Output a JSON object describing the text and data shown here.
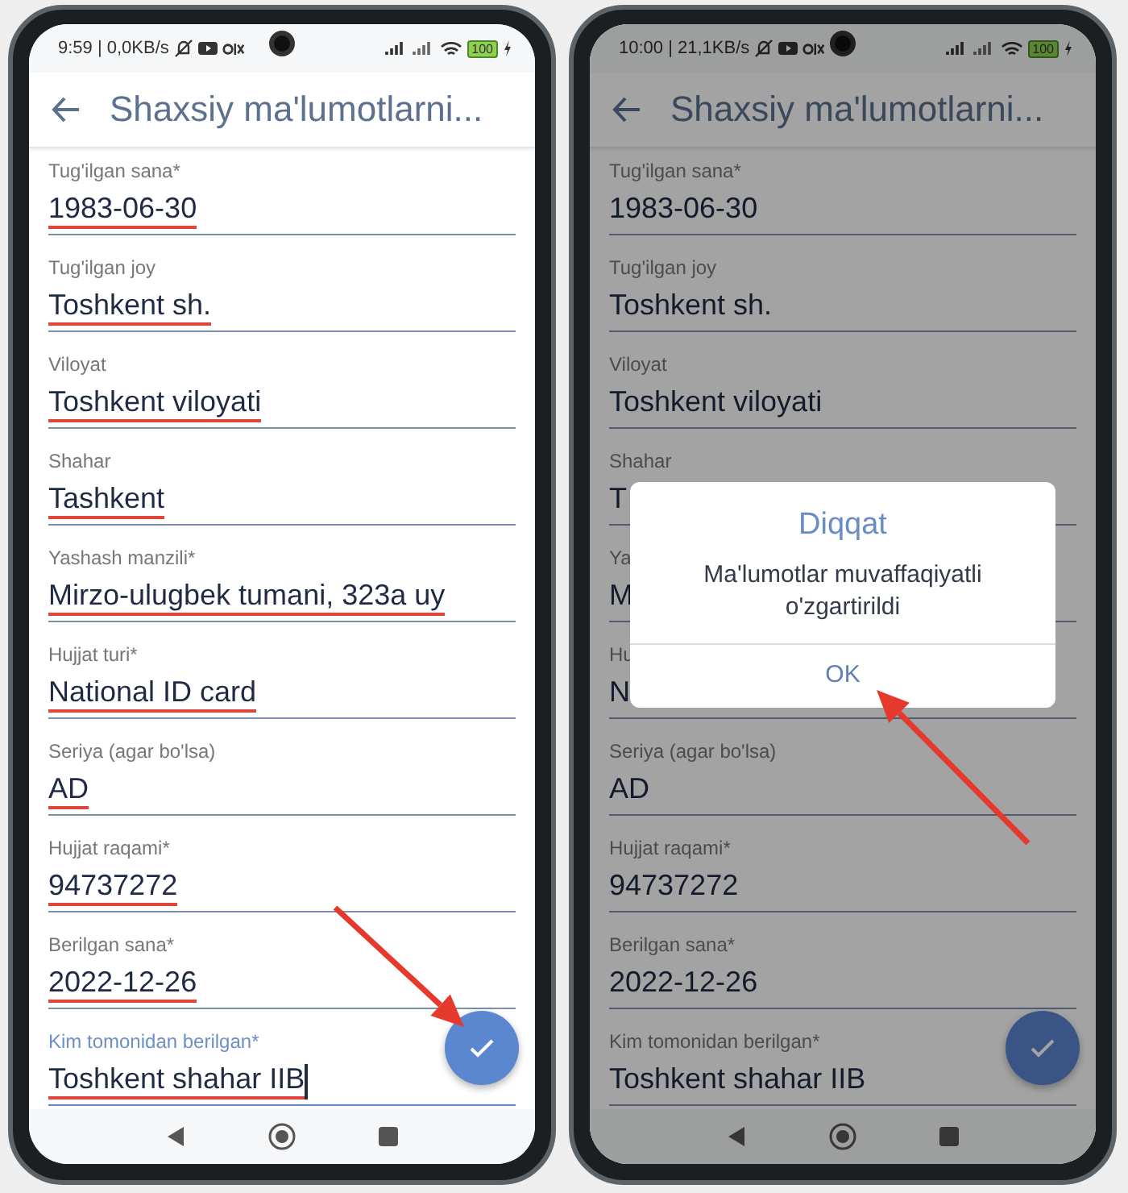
{
  "phones": [
    {
      "status_bar": {
        "time_and_speed": "9:59 | 0,0KB/s",
        "battery": "100"
      },
      "app_bar": {
        "title": "Shaxsiy ma'lumotlarni..."
      },
      "dimmed": false,
      "arrow": true,
      "fields": [
        {
          "label": "Tug'ilgan sana*",
          "value": "1983-06-30",
          "marked": true,
          "focused": false
        },
        {
          "label": "Tug'ilgan joy",
          "value": "Toshkent sh.",
          "marked": true,
          "focused": false
        },
        {
          "label": "Viloyat",
          "value": "Toshkent viloyati",
          "marked": true,
          "focused": false
        },
        {
          "label": "Shahar",
          "value": "Tashkent",
          "marked": true,
          "focused": false
        },
        {
          "label": "Yashash manzili*",
          "value": "Mirzo-ulugbek tumani, 323a uy",
          "marked": true,
          "focused": false
        },
        {
          "label": "Hujjat turi*",
          "value": "National ID card",
          "marked": true,
          "focused": false
        },
        {
          "label": "Seriya (agar bo'lsa)",
          "value": "AD",
          "marked": true,
          "focused": false
        },
        {
          "label": "Hujjat raqami*",
          "value": "94737272",
          "marked": true,
          "focused": false
        },
        {
          "label": "Berilgan sana*",
          "value": "2022-12-26",
          "marked": true,
          "focused": false
        },
        {
          "label": "Kim tomonidan berilgan*",
          "value": "Toshkent shahar IIB",
          "marked": true,
          "focused": true
        }
      ]
    },
    {
      "status_bar": {
        "time_and_speed": "10:00 | 21,1KB/s",
        "battery": "100"
      },
      "app_bar": {
        "title": "Shaxsiy ma'lumotlarni..."
      },
      "dimmed": true,
      "arrow": true,
      "fields": [
        {
          "label": "Tug'ilgan sana*",
          "value": "1983-06-30",
          "marked": false,
          "focused": false
        },
        {
          "label": "Tug'ilgan joy",
          "value": "Toshkent sh.",
          "marked": false,
          "focused": false
        },
        {
          "label": "Viloyat",
          "value": "Toshkent viloyati",
          "marked": false,
          "focused": false
        },
        {
          "label": "Shahar",
          "value": "T",
          "marked": false,
          "focused": false
        },
        {
          "label": "Ya",
          "value": "M",
          "marked": false,
          "focused": false
        },
        {
          "label": "Hu",
          "value": "N",
          "marked": false,
          "focused": false
        },
        {
          "label": "Seriya (agar bo'lsa)",
          "value": "AD",
          "marked": false,
          "focused": false
        },
        {
          "label": "Hujjat raqami*",
          "value": "94737272",
          "marked": false,
          "focused": false
        },
        {
          "label": "Berilgan sana*",
          "value": "2022-12-26",
          "marked": false,
          "focused": false
        },
        {
          "label": "Kim tomonidan berilgan*",
          "value": "Toshkent shahar IIB",
          "marked": false,
          "focused": false
        }
      ],
      "dialog": {
        "title": "Diqqat",
        "message": "Ma'lumotlar muvaffaqiyatli o'zgartirildi",
        "button": "OK"
      }
    }
  ]
}
